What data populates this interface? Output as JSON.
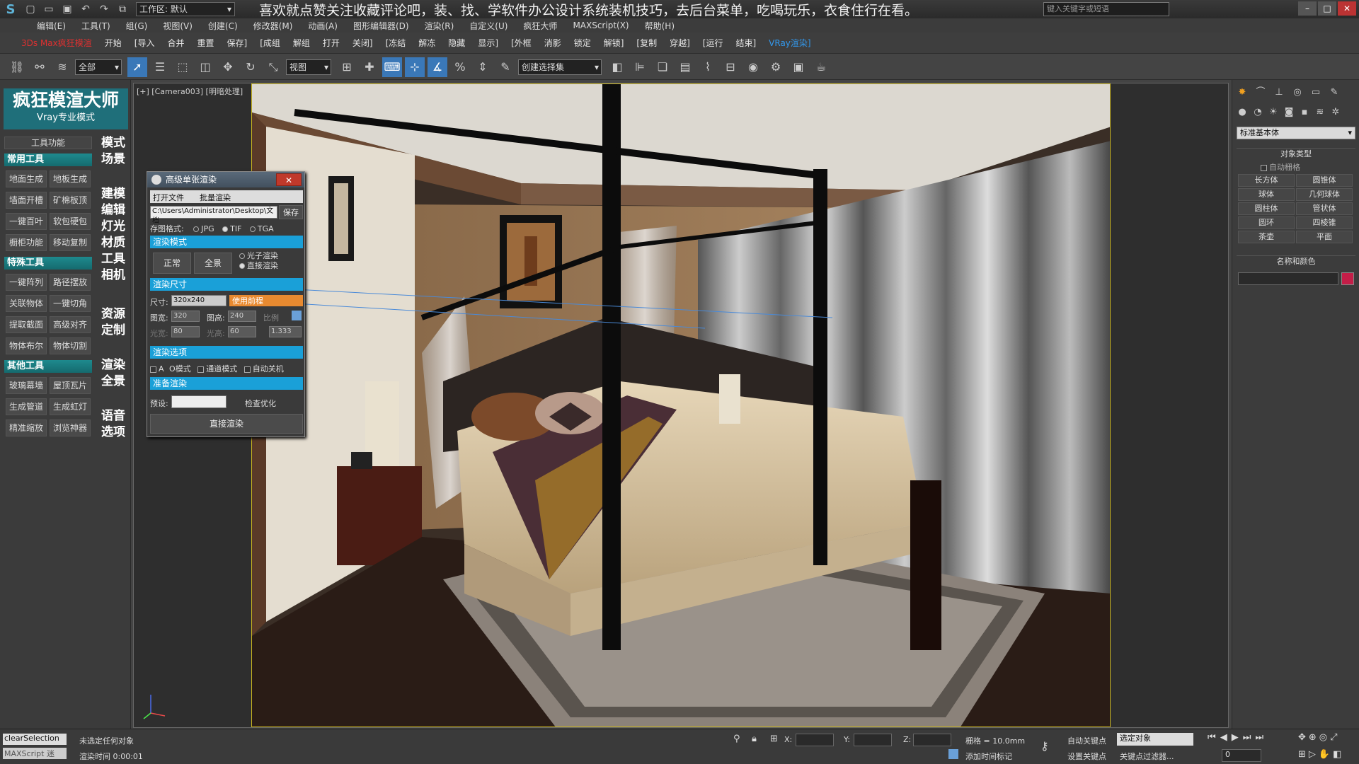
{
  "titlebar": {
    "workspace": "工作区: 默认",
    "title": "喜欢就点赞关注收藏评论吧，装、找、学软件办公设计系统装机技巧，去后台菜单，吃喝玩乐，衣食住行在看。",
    "search_placeholder": "键入关键字或短语"
  },
  "menu": [
    "编辑(E)",
    "工具(T)",
    "组(G)",
    "视图(V)",
    "创建(C)",
    "修改器(M)",
    "动画(A)",
    "图形编辑器(D)",
    "渲染(R)",
    "自定义(U)",
    "疯狂大师",
    "MAXScript(X)",
    "帮助(H)"
  ],
  "cmdbar": {
    "left": "3Ds Max疯狂模渲",
    "items": [
      "开始",
      "[导入",
      "合并",
      "重置",
      "保存]",
      "[成组",
      "解组",
      "打开",
      "关闭]",
      "[冻结",
      "解冻",
      "隐藏",
      "显示]",
      "[外框",
      "消影",
      "锁定",
      "解锁]",
      "[复制",
      "穿越]",
      "[运行",
      "结束]"
    ],
    "right": "VRay渲染]"
  },
  "toolbar": {
    "filter": "全部",
    "view": "视图",
    "selset": "创建选择集"
  },
  "leftpanel": {
    "brand_title": "疯狂模渲大师",
    "brand_sub": "Vray专业模式",
    "toolfunc": "工具功能",
    "sections": [
      {
        "title": "常用工具",
        "buttons": [
          "地面生成",
          "地板生成",
          "墙面开槽",
          "矿棉板顶",
          "一键百叶",
          "软包硬包",
          "橱柜功能",
          "移动复制"
        ]
      },
      {
        "title": "特殊工具",
        "buttons": [
          "一键阵列",
          "路径摆放",
          "关联物体",
          "一键切角",
          "提取截面",
          "高级对齐",
          "物体布尔",
          "物体切割"
        ]
      },
      {
        "title": "其他工具",
        "buttons": [
          "玻璃幕墙",
          "屋顶瓦片",
          "生成管道",
          "生成虹灯",
          "精准缩放",
          "浏览神器"
        ]
      }
    ],
    "categories": [
      "模式",
      "场景",
      "建模",
      "编辑",
      "灯光",
      "材质",
      "工具",
      "相机",
      "资源",
      "定制",
      "渲染",
      "全景",
      "语音",
      "选项"
    ]
  },
  "viewport": {
    "label": "[+] [Camera003] [明暗处理]"
  },
  "dialog": {
    "title": "高级单张渲染",
    "open_file": "打开文件",
    "batch": "批量渲染",
    "path": "C:\\Users\\Administrator\\Desktop\\文档",
    "save": "保存",
    "format_label": "存图格式:",
    "formats": [
      "JPG",
      "TIF",
      "TGA"
    ],
    "mode_section": "渲染模式",
    "normal": "正常",
    "pano": "全景",
    "photon": "光子渲染",
    "direct": "直接渲染",
    "size_section": "渲染尺寸",
    "size_label": "尺寸:",
    "size_value": "320x240",
    "use_scale": "使用前程",
    "w_label": "图宽:",
    "w": "320",
    "h_label": "图高:",
    "h": "240",
    "ratio_label": "比例",
    "pw_label": "光宽:",
    "pw": "80",
    "ph_label": "光高:",
    "ph": "60",
    "ratio": "1.333",
    "opt_section": "渲染选项",
    "a_mode": "A",
    "o_mode": "O模式",
    "channel": "通道模式",
    "auto_off": "自动关机",
    "prep_section": "准备渲染",
    "preset_label": "预设:",
    "check": "检查优化",
    "render": "直接渲染"
  },
  "rightpanel": {
    "dropdown": "标准基本体",
    "objtype": "对象类型",
    "autogrid": "自动栅格",
    "buttons": [
      "长方体",
      "圆锥体",
      "球体",
      "几何球体",
      "圆柱体",
      "管状体",
      "圆环",
      "四棱锥",
      "茶壶",
      "平面"
    ],
    "namecolor": "名称和颜色",
    "color": "#c41e48"
  },
  "status": {
    "script1": "clearSelection",
    "script2": "MAXScript 迷",
    "msg1": "未选定任何对象",
    "msg2": "渲染时间 0:00:01",
    "x": "X:",
    "y": "Y:",
    "z": "Z:",
    "grid": "栅格 = 10.0mm",
    "autokey": "自动关键点",
    "setkey": "设置关键点",
    "selected": "选定对象",
    "addtime": "添加时间标记",
    "keyfilter": "关键点过滤器...",
    "frame": "0"
  }
}
